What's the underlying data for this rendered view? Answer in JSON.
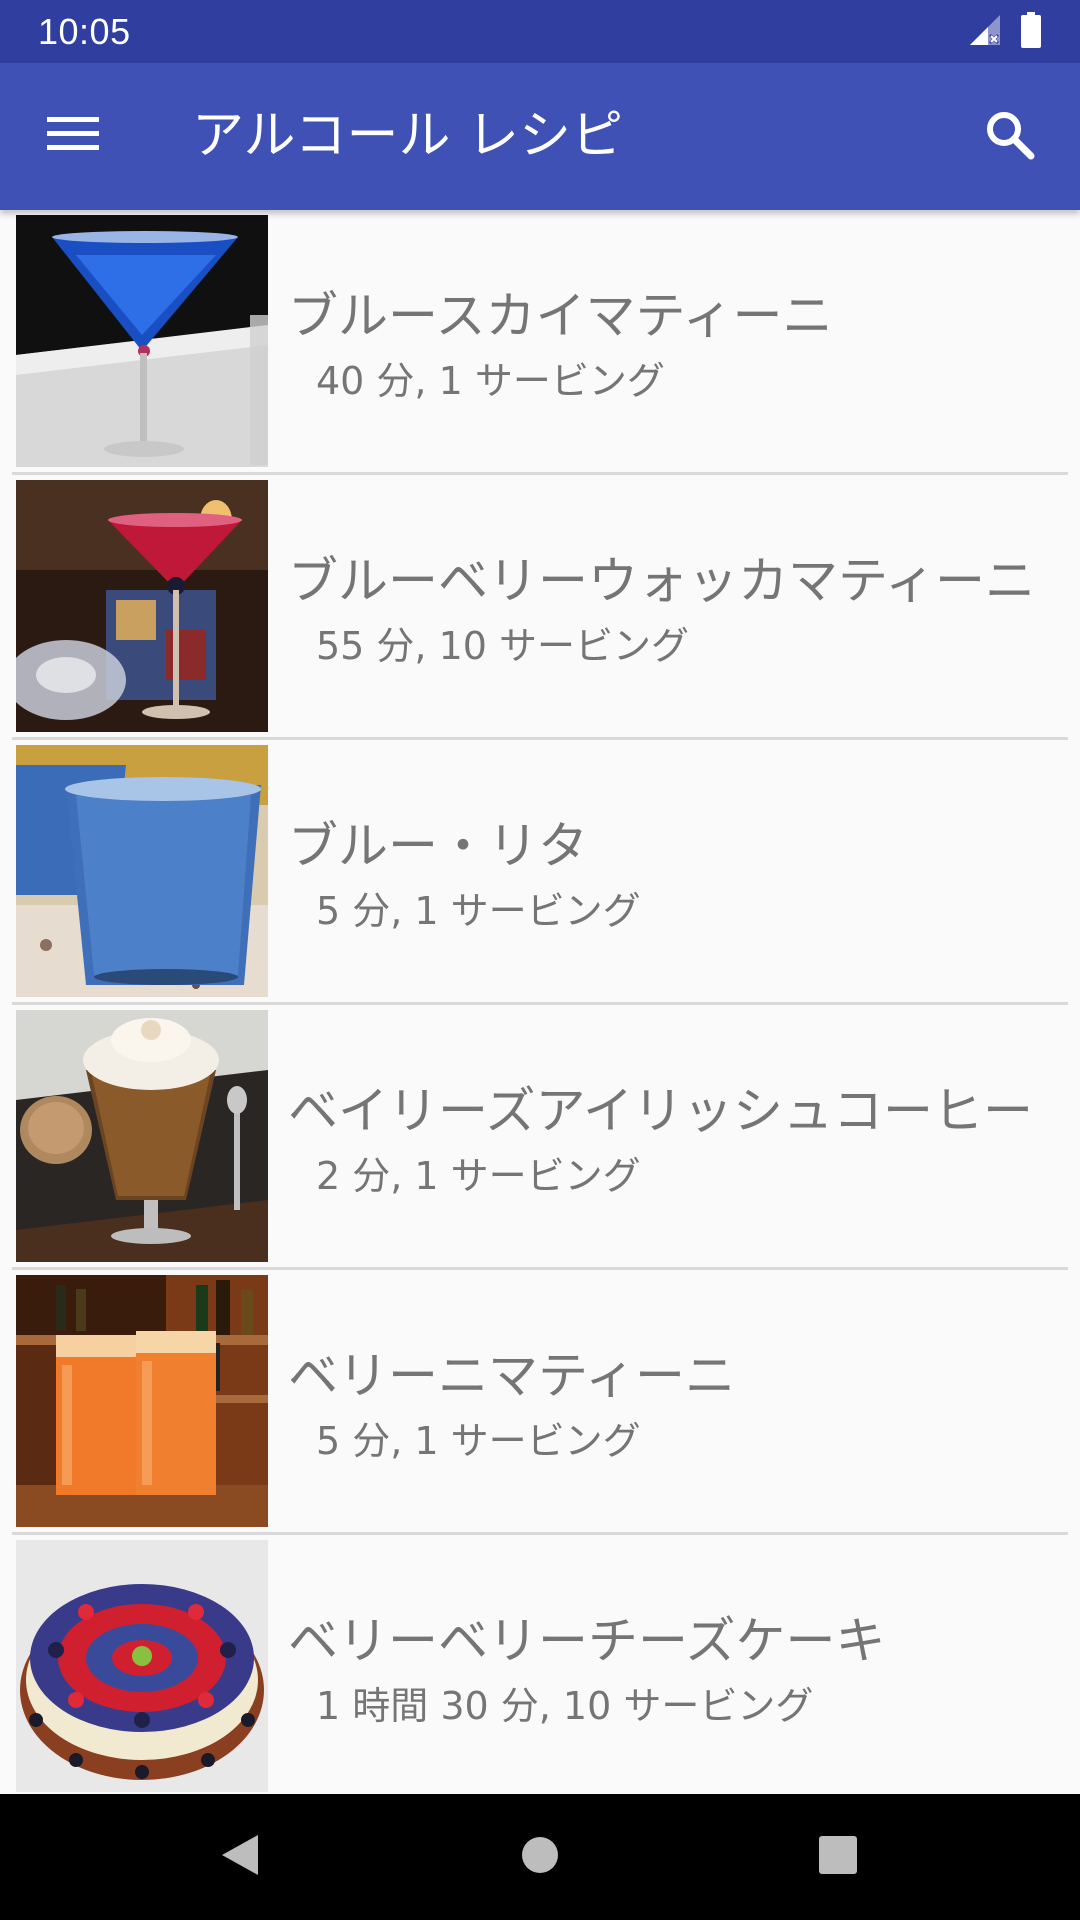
{
  "status_bar": {
    "time": "10:05",
    "icons": [
      "signal-icon",
      "battery-icon"
    ]
  },
  "app_bar": {
    "title": "アルコール レシピ",
    "menu_icon": "menu-icon",
    "search_icon": "search-icon",
    "color": "#3f51b5"
  },
  "recipes": [
    {
      "name": "ブルースカイマティーニ",
      "meta": "40 分, 1 サービング"
    },
    {
      "name": "ブルーベリーウォッカマティーニ",
      "meta": "55 分, 10 サービング"
    },
    {
      "name": "ブルー・リタ",
      "meta": "5 分, 1 サービング"
    },
    {
      "name": "ベイリーズアイリッシュコーヒー",
      "meta": "2 分, 1 サービング"
    },
    {
      "name": "ベリーニマティーニ",
      "meta": "5 分, 1 サービング"
    },
    {
      "name": "ベリーベリーチーズケーキ",
      "meta": "1 時間 30 分, 10 サービング"
    }
  ],
  "nav_bar": {
    "back_icon": "back-icon",
    "home_icon": "home-icon",
    "recents_icon": "recents-icon"
  }
}
